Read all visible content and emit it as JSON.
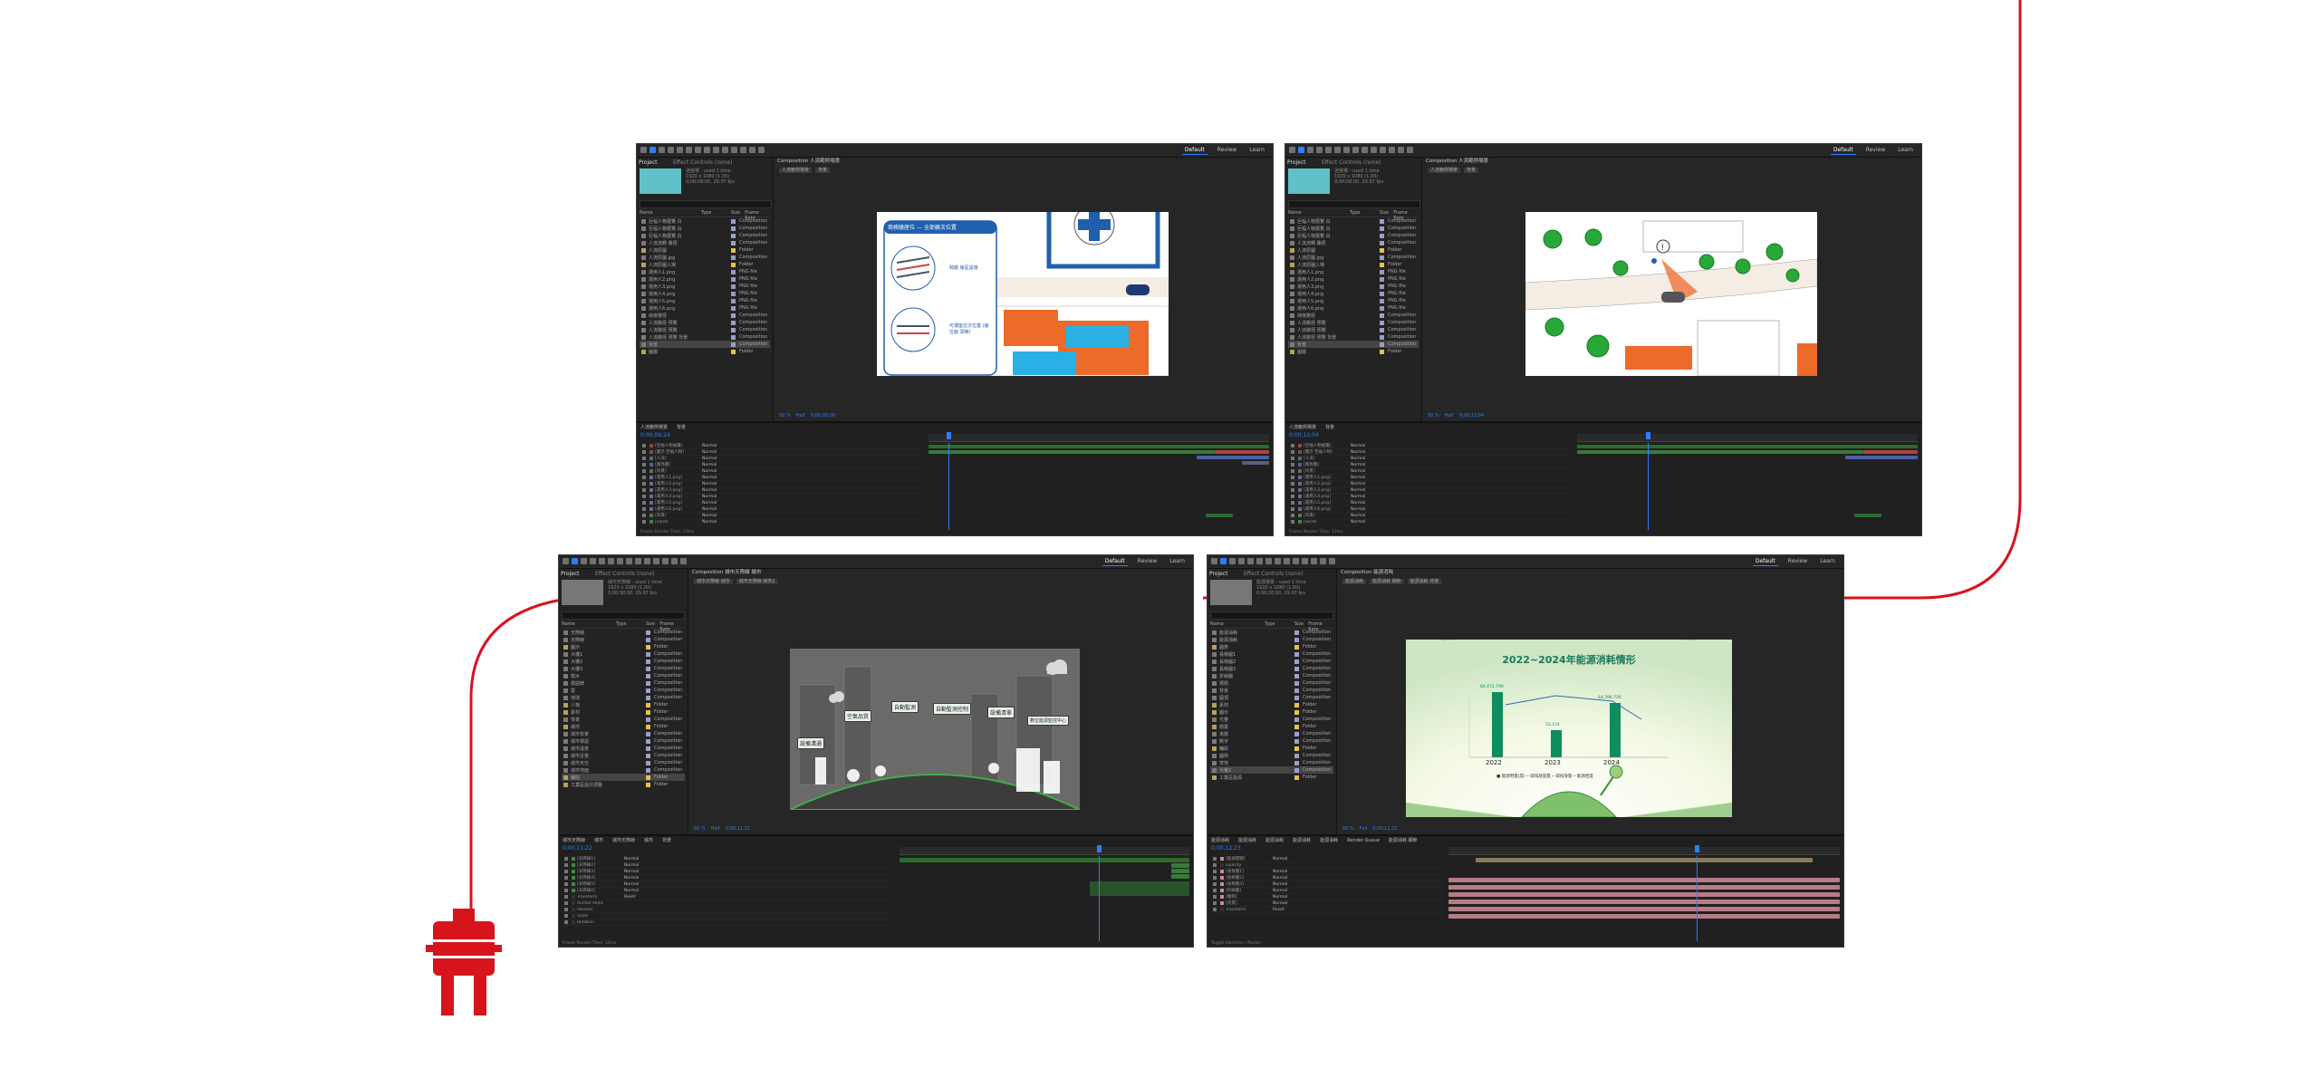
{
  "accent": "#2f7dff",
  "cord_color": "#d7141c",
  "plug_icon": "power-plug-icon",
  "windows": [
    {
      "id": "win1",
      "workspaces": [
        "Default",
        "Review",
        "Learn"
      ],
      "project_tab": "Project",
      "effects_tab": "Effect Controls (none)",
      "thumb_color": "#5fc1c9",
      "project_info": [
        "迷宮場 - used 1 time",
        "1920 x 1080 (1.00)",
        "0;00;08;00, 29.97 fps"
      ],
      "file_headers": [
        "Name",
        "Type",
        "Size",
        "Frame Rate"
      ],
      "files": [
        {
          "name": "巨幅人物展覽 白",
          "type": "Composition",
          "color": "#9aa0c8"
        },
        {
          "name": "巨幅人物展覽 白",
          "type": "Composition",
          "color": "#9aa0c8"
        },
        {
          "name": "巨幅人物展覽 白",
          "type": "Composition",
          "color": "#9aa0c8"
        },
        {
          "name": "人流流轉 路徑",
          "type": "Composition",
          "color": "#9aa0c8"
        },
        {
          "name": "人流原圖",
          "type": "Folder",
          "color": "#e5c24a"
        },
        {
          "name": "人流原圖.jpg",
          "type": "Composition",
          "color": "#9aa0c8"
        },
        {
          "name": "人流原圖入場",
          "type": "Folder",
          "color": "#e5c24a"
        },
        {
          "name": "運用人1.png",
          "type": "PNG file",
          "color": "#9a9ac0"
        },
        {
          "name": "運用人2.png",
          "type": "PNG file",
          "color": "#9a9ac0"
        },
        {
          "name": "運用人3.png",
          "type": "PNG file",
          "color": "#9a9ac0"
        },
        {
          "name": "運用人4.png",
          "type": "PNG file",
          "color": "#9a9ac0"
        },
        {
          "name": "運用人5.png",
          "type": "PNG file",
          "color": "#9a9ac0"
        },
        {
          "name": "運用人6.png",
          "type": "PNG file",
          "color": "#9a9ac0"
        },
        {
          "name": "緯度路徑",
          "type": "Composition",
          "color": "#9aa0c8"
        },
        {
          "name": "人流路徑 預覽",
          "type": "Composition",
          "color": "#9aa0c8"
        },
        {
          "name": "人流路徑 預覽",
          "type": "Composition",
          "color": "#9aa0c8"
        },
        {
          "name": "人流路徑 預覽 背景",
          "type": "Composition",
          "color": "#9aa0c8"
        },
        {
          "name": "背景",
          "type": "Composition",
          "color": "#9aa0c8"
        },
        {
          "name": "圖層",
          "type": "Folder",
          "color": "#e5c24a"
        }
      ],
      "viewer_tab": "Composition 人流範例場景",
      "viewer_subtabs": [
        "人流範例場景",
        "背景"
      ],
      "viewer_bar": [
        "50 %",
        "Half",
        "0;00;00;00"
      ],
      "timeline_tabs": [
        "人流範例場景",
        "背景"
      ],
      "timecode": "0;00;09;24",
      "layers": [
        {
          "name": "[巨幅人物展覽]",
          "mode": "Normal",
          "color": "#8a4a4a"
        },
        {
          "name": "[圖示 巨幅人物]",
          "mode": "Normal",
          "color": "#8a4a4a"
        },
        {
          "name": "[人流]",
          "mode": "Normal",
          "color": "#4a6a8a"
        },
        {
          "name": "[路徑圖]",
          "mode": "Normal",
          "color": "#4a6a8a"
        },
        {
          "name": "[背景]",
          "mode": "Normal",
          "color": "#6a6a6a"
        },
        {
          "name": "[運用人1.png]",
          "mode": "Normal",
          "color": "#6a6a9a"
        },
        {
          "name": "[運用人2.png]",
          "mode": "Normal",
          "color": "#6a6a9a"
        },
        {
          "name": "[運用人3.png]",
          "mode": "Normal",
          "color": "#6a6a9a"
        },
        {
          "name": "[運用人4.png]",
          "mode": "Normal",
          "color": "#6a6a9a"
        },
        {
          "name": "[運用人5.png]",
          "mode": "Normal",
          "color": "#6a6a9a"
        },
        {
          "name": "[運用人6.png]",
          "mode": "Normal",
          "color": "#6a6a9a"
        },
        {
          "name": "[背景]",
          "mode": "Normal",
          "color": "#6a6a6a"
        },
        {
          "name": "[Solid]",
          "mode": "Normal",
          "color": "#3e8a3e"
        }
      ],
      "status": "Frame Render Time: 13ms",
      "art": {
        "callout_title": "商務艙座位 — 全部艙次位置",
        "callout_a": "跨越 艙區設施",
        "callout_b": "可選座位次位置 (艙位艙 頭等)"
      }
    },
    {
      "id": "win2",
      "workspaces": [
        "Default",
        "Review",
        "Learn"
      ],
      "project_tab": "Project",
      "effects_tab": "Effect Controls (none)",
      "thumb_color": "#5fc1c9",
      "project_info": [
        "迷宮場 - used 1 time",
        "1920 x 1080 (1.00)",
        "0;00;08;00, 29.97 fps"
      ],
      "file_headers": [
        "Name",
        "Type",
        "Size",
        "Frame Rate"
      ],
      "files": [
        {
          "name": "巨幅人物展覽 白",
          "type": "Composition",
          "color": "#9aa0c8"
        },
        {
          "name": "巨幅人物展覽 白",
          "type": "Composition",
          "color": "#9aa0c8"
        },
        {
          "name": "巨幅人物展覽 白",
          "type": "Composition",
          "color": "#9aa0c8"
        },
        {
          "name": "人流流轉 路徑",
          "type": "Composition",
          "color": "#9aa0c8"
        },
        {
          "name": "人流原圖",
          "type": "Folder",
          "color": "#e5c24a"
        },
        {
          "name": "人流原圖.jpg",
          "type": "Composition",
          "color": "#9aa0c8"
        },
        {
          "name": "人流原圖入場",
          "type": "Folder",
          "color": "#e5c24a"
        },
        {
          "name": "運用人1.png",
          "type": "PNG file",
          "color": "#9a9ac0"
        },
        {
          "name": "運用人2.png",
          "type": "PNG file",
          "color": "#9a9ac0"
        },
        {
          "name": "運用人3.png",
          "type": "PNG file",
          "color": "#9a9ac0"
        },
        {
          "name": "運用人4.png",
          "type": "PNG file",
          "color": "#9a9ac0"
        },
        {
          "name": "運用人5.png",
          "type": "PNG file",
          "color": "#9a9ac0"
        },
        {
          "name": "運用人6.png",
          "type": "PNG file",
          "color": "#9a9ac0"
        },
        {
          "name": "緯度路徑",
          "type": "Composition",
          "color": "#9aa0c8"
        },
        {
          "name": "人流路徑 預覽",
          "type": "Composition",
          "color": "#9aa0c8"
        },
        {
          "name": "人流路徑 預覽",
          "type": "Composition",
          "color": "#9aa0c8"
        },
        {
          "name": "人流路徑 預覽 背景",
          "type": "Composition",
          "color": "#9aa0c8"
        },
        {
          "name": "背景",
          "type": "Composition",
          "color": "#9aa0c8"
        },
        {
          "name": "圖層",
          "type": "Folder",
          "color": "#e5c24a"
        }
      ],
      "viewer_tab": "Composition 人流範例場景",
      "viewer_subtabs": [
        "人流範例場景",
        "背景"
      ],
      "viewer_bar": [
        "50 %",
        "Half",
        "0;00;12;04"
      ],
      "timeline_tabs": [
        "人流範例場景",
        "背景"
      ],
      "timecode": "0;00;12;04",
      "layers": [
        {
          "name": "[巨幅人物展覽]",
          "mode": "Normal",
          "color": "#8a4a4a"
        },
        {
          "name": "[圖示 巨幅人物]",
          "mode": "Normal",
          "color": "#8a4a4a"
        },
        {
          "name": "[人流]",
          "mode": "Normal",
          "color": "#4a6a8a"
        },
        {
          "name": "[路徑圖]",
          "mode": "Normal",
          "color": "#4a6a8a"
        },
        {
          "name": "[背景]",
          "mode": "Normal",
          "color": "#6a6a6a"
        },
        {
          "name": "[運用人1.png]",
          "mode": "Normal",
          "color": "#6a6a9a"
        },
        {
          "name": "[運用人2.png]",
          "mode": "Normal",
          "color": "#6a6a9a"
        },
        {
          "name": "[運用人3.png]",
          "mode": "Normal",
          "color": "#6a6a9a"
        },
        {
          "name": "[運用人4.png]",
          "mode": "Normal",
          "color": "#6a6a9a"
        },
        {
          "name": "[運用人5.png]",
          "mode": "Normal",
          "color": "#6a6a9a"
        },
        {
          "name": "[運用人6.png]",
          "mode": "Normal",
          "color": "#6a6a9a"
        },
        {
          "name": "[背景]",
          "mode": "Normal",
          "color": "#6a6a6a"
        },
        {
          "name": "[Solid]",
          "mode": "Normal",
          "color": "#3e8a3e"
        }
      ],
      "status": "Frame Render Time: 13ms",
      "art": {}
    },
    {
      "id": "win3",
      "workspaces": [
        "Default",
        "Review",
        "Learn"
      ],
      "project_tab": "Project",
      "effects_tab": "Effect Controls (none)",
      "thumb_color": "#777777",
      "project_info": [
        "城市天際線 - used 1 time",
        "1920 x 1080 (1.00)",
        "0;00;30;00, 29.97 fps"
      ],
      "file_headers": [
        "Name",
        "Type",
        "Size",
        "Frame Rate"
      ],
      "files": [
        {
          "name": "天際線",
          "type": "Composition",
          "color": "#9aa0c8"
        },
        {
          "name": "天際線",
          "type": "Composition",
          "color": "#9aa0c8"
        },
        {
          "name": "圖示",
          "type": "Folder",
          "color": "#e5c24a"
        },
        {
          "name": "大樓1",
          "type": "Composition",
          "color": "#9aa0c8"
        },
        {
          "name": "大樓2",
          "type": "Composition",
          "color": "#9aa0c8"
        },
        {
          "name": "大樓3",
          "type": "Composition",
          "color": "#9aa0c8"
        },
        {
          "name": "樹木",
          "type": "Composition",
          "color": "#9aa0c8"
        },
        {
          "name": "標語牌",
          "type": "Composition",
          "color": "#9aa0c8"
        },
        {
          "name": "雲",
          "type": "Composition",
          "color": "#9aa0c8"
        },
        {
          "name": "地球",
          "type": "Composition",
          "color": "#9aa0c8"
        },
        {
          "name": "人物",
          "type": "Folder",
          "color": "#e5c24a"
        },
        {
          "name": "素材",
          "type": "Folder",
          "color": "#e5c24a"
        },
        {
          "name": "背景",
          "type": "Composition",
          "color": "#9aa0c8"
        },
        {
          "name": "城市",
          "type": "Folder",
          "color": "#e5c24a"
        },
        {
          "name": "城市背景",
          "type": "Composition",
          "color": "#9aa0c8"
        },
        {
          "name": "城市標語",
          "type": "Composition",
          "color": "#9aa0c8"
        },
        {
          "name": "城市遠景",
          "type": "Composition",
          "color": "#9aa0c8"
        },
        {
          "name": "城市近景",
          "type": "Composition",
          "color": "#9aa0c8"
        },
        {
          "name": "城市天空",
          "type": "Composition",
          "color": "#9aa0c8"
        },
        {
          "name": "城市地面",
          "type": "Composition",
          "color": "#9aa0c8"
        },
        {
          "name": "輔助",
          "type": "Folder",
          "color": "#e5c24a"
        },
        {
          "name": "工業區設計調整",
          "type": "Folder",
          "color": "#e5c24a"
        }
      ],
      "viewer_tab": "Composition 城市天際線 城市",
      "viewer_subtabs": [
        "城市天際線 城市",
        "城市天際線 城市2"
      ],
      "viewer_bar": [
        "50 %",
        "Half",
        "0;00;11;22"
      ],
      "timeline_tabs": [
        "城市天際線",
        "城市",
        "城市天際線",
        "城市",
        "背景"
      ],
      "timecode": "0;00;11;22",
      "layers": [
        {
          "name": "[天際線1]",
          "mode": "Normal",
          "color": "#3e8a3e"
        },
        {
          "name": "[天際線2]",
          "mode": "Normal",
          "color": "#3e8a3e"
        },
        {
          "name": "[天際線3]",
          "mode": "Normal",
          "color": "#3e8a3e"
        },
        {
          "name": "[天際線4]",
          "mode": "Normal",
          "color": "#3e8a3e"
        },
        {
          "name": "[天際線5]",
          "mode": "Normal",
          "color": "#3e8a3e"
        },
        {
          "name": "[天際線6]",
          "mode": "Normal",
          "color": "#3e8a3e"
        },
        {
          "name": "Transform",
          "mode": "Reset",
          "color": "#333333"
        },
        {
          "name": "Anchor Point",
          "mode": "",
          "color": "#333333"
        },
        {
          "name": "Position",
          "mode": "",
          "color": "#333333"
        },
        {
          "name": "Scale",
          "mode": "",
          "color": "#333333"
        },
        {
          "name": "Rotation",
          "mode": "",
          "color": "#333333"
        }
      ],
      "status": "Frame Render Time: 12ms",
      "art": {
        "signs": [
          "空氣品質",
          "自動監測",
          "自動監測控制",
          "設備清單",
          "設備溝通",
          "數位能源監控中心"
        ]
      }
    },
    {
      "id": "win4",
      "workspaces": [
        "Default",
        "Review",
        "Learn"
      ],
      "project_tab": "Project",
      "effects_tab": "Effect Controls (none)",
      "thumb_color": "#777777",
      "project_info": [
        "能源場景 - used 1 time",
        "1920 x 1080 (1.00)",
        "0;00;20;00, 29.97 fps"
      ],
      "file_headers": [
        "Name",
        "Type",
        "Size",
        "Frame Rate"
      ],
      "files": [
        {
          "name": "能源消耗",
          "type": "Composition",
          "color": "#9aa0c8"
        },
        {
          "name": "能源消耗",
          "type": "Composition",
          "color": "#9aa0c8"
        },
        {
          "name": "圖表",
          "type": "Folder",
          "color": "#e5c24a"
        },
        {
          "name": "長條圖1",
          "type": "Composition",
          "color": "#9aa0c8"
        },
        {
          "name": "長條圖2",
          "type": "Composition",
          "color": "#9aa0c8"
        },
        {
          "name": "長條圖3",
          "type": "Composition",
          "color": "#9aa0c8"
        },
        {
          "name": "折線圖",
          "type": "Composition",
          "color": "#9aa0c8"
        },
        {
          "name": "標題",
          "type": "Composition",
          "color": "#9aa0c8"
        },
        {
          "name": "背景",
          "type": "Composition",
          "color": "#9aa0c8"
        },
        {
          "name": "圓頂",
          "type": "Composition",
          "color": "#9aa0c8"
        },
        {
          "name": "素材",
          "type": "Folder",
          "color": "#e5c24a"
        },
        {
          "name": "圖示",
          "type": "Folder",
          "color": "#e5c24a"
        },
        {
          "name": "光暈",
          "type": "Composition",
          "color": "#9aa0c8"
        },
        {
          "name": "樹葉",
          "type": "Folder",
          "color": "#e5c24a"
        },
        {
          "name": "漸層",
          "type": "Composition",
          "color": "#9aa0c8"
        },
        {
          "name": "數字",
          "type": "Composition",
          "color": "#9aa0c8"
        },
        {
          "name": "輔助",
          "type": "Folder",
          "color": "#e5c24a"
        },
        {
          "name": "圖例",
          "type": "Composition",
          "color": "#9aa0c8"
        },
        {
          "name": "草地",
          "type": "Composition",
          "color": "#9aa0c8"
        },
        {
          "name": "光暈2",
          "type": "Composition",
          "color": "#9aa0c8"
        },
        {
          "name": "工業區能源",
          "type": "Folder",
          "color": "#e5c24a"
        }
      ],
      "viewer_tab": "Composition 能源消耗",
      "viewer_subtabs": [
        "能源消耗",
        "能源消耗 細節",
        "能源消耗 背景"
      ],
      "viewer_bar": [
        "50 %",
        "Full",
        "0;00;11;22"
      ],
      "timeline_tabs": [
        "能源消耗",
        "能源消耗",
        "能源消耗",
        "能源消耗",
        "能源消耗",
        "Render Queue",
        "能源消耗 細節"
      ],
      "timecode": "0;00;12;23",
      "layers": [
        {
          "name": "[能源標題]",
          "mode": "Normal",
          "color": "#c98a9a"
        },
        {
          "name": "Opacity",
          "mode": "",
          "color": "#333333"
        },
        {
          "name": "[長條圖1]",
          "mode": "Normal",
          "color": "#c98a9a"
        },
        {
          "name": "[長條圖2]",
          "mode": "Normal",
          "color": "#c98a9a"
        },
        {
          "name": "[長條圖3]",
          "mode": "Normal",
          "color": "#c98a9a"
        },
        {
          "name": "[折線圖]",
          "mode": "Normal",
          "color": "#c98a9a"
        },
        {
          "name": "[圖例]",
          "mode": "Normal",
          "color": "#c98a9a"
        },
        {
          "name": "[背景]",
          "mode": "Normal",
          "color": "#c98a9a"
        },
        {
          "name": "Transform",
          "mode": "Reset",
          "color": "#333333"
        }
      ],
      "status": "Toggle Switches / Modes",
      "art": {
        "chart_title": "2022~2024年能源消耗情形",
        "years": [
          "2022",
          "2023",
          "2024"
        ],
        "bar_labels": [
          "84,472.799",
          "33,154",
          "44,396.726"
        ],
        "legend": "■ 能源用量(度)  ─ 碳排放當量  ─ 碳排放量  ─ 能源密度"
      }
    }
  ]
}
